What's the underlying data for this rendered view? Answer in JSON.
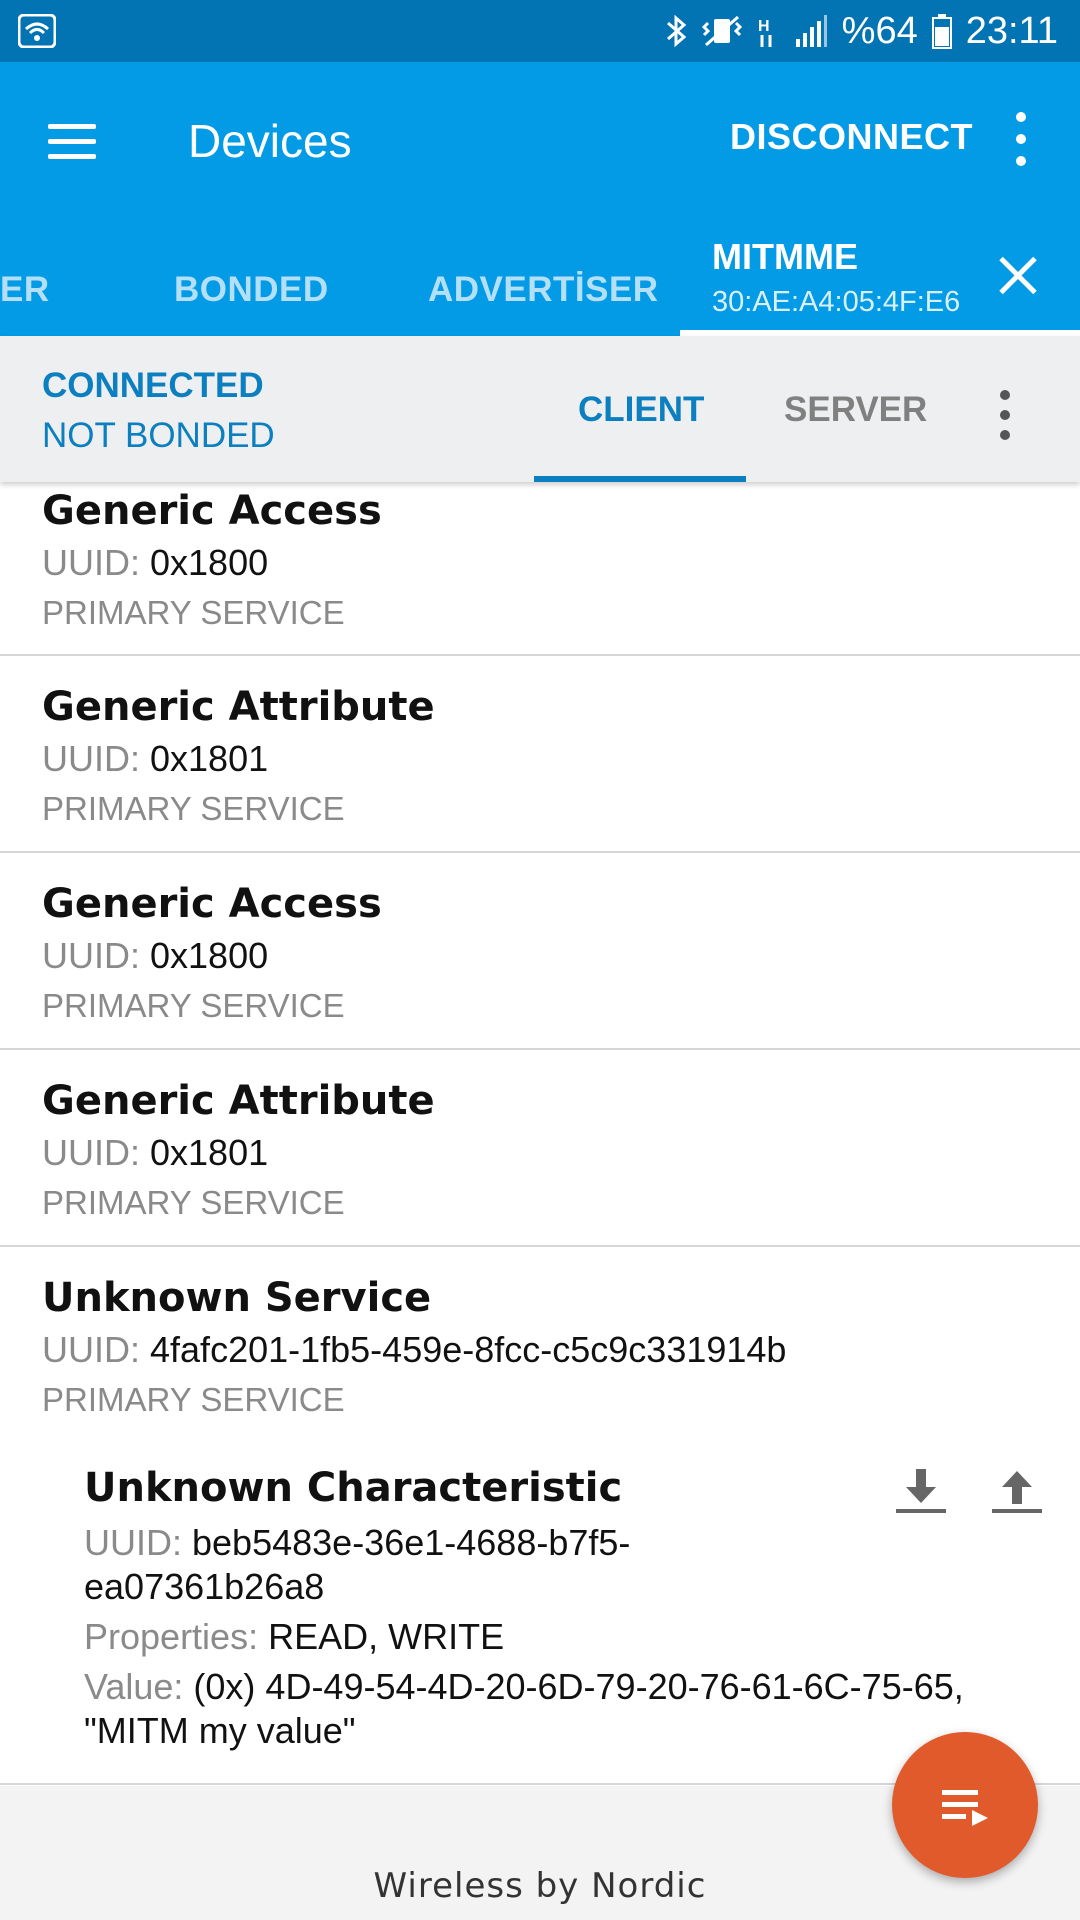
{
  "status_bar": {
    "battery": "%64",
    "time": "23:11",
    "icons": [
      "wifi-icon",
      "bluetooth-icon",
      "vibrate-icon",
      "network-h-icon",
      "signal-icon",
      "battery-icon"
    ]
  },
  "app_bar": {
    "title": "Devices",
    "disconnect_label": "DISCONNECT"
  },
  "device_tabs": {
    "items": [
      {
        "label": "ER"
      },
      {
        "label": "BONDED"
      },
      {
        "label": "ADVERTİSER"
      }
    ],
    "active": {
      "name": "MITMME",
      "address": "30:AE:A4:05:4F:E6"
    }
  },
  "connection": {
    "state": "CONNECTED",
    "bond": "NOT BONDED",
    "tabs": {
      "client": "CLIENT",
      "server": "SERVER"
    }
  },
  "services": [
    {
      "name": "Generic Access",
      "uuid_label": "UUID:",
      "uuid": "0x1800",
      "type": "PRIMARY SERVICE"
    },
    {
      "name": "Generic Attribute",
      "uuid_label": "UUID:",
      "uuid": "0x1801",
      "type": "PRIMARY SERVICE"
    },
    {
      "name": "Generic Access",
      "uuid_label": "UUID:",
      "uuid": "0x1800",
      "type": "PRIMARY SERVICE"
    },
    {
      "name": "Generic Attribute",
      "uuid_label": "UUID:",
      "uuid": "0x1801",
      "type": "PRIMARY SERVICE"
    },
    {
      "name": "Unknown Service",
      "uuid_label": "UUID:",
      "uuid": "4fafc201-1fb5-459e-8fcc-c5c9c331914b",
      "type": "PRIMARY SERVICE"
    }
  ],
  "characteristic": {
    "name": "Unknown Characteristic",
    "uuid_label": "UUID:",
    "uuid_line1": "beb5483e-36e1-4688-b7f5-",
    "uuid_line2": "ea07361b26a8",
    "properties_label": "Properties:",
    "properties": "READ, WRITE",
    "value_label": "Value:",
    "value_line1": "(0x) 4D-49-54-4D-20-6D-79-20-76-61-6C-75-65,",
    "value_line2": "\"MITM my value\""
  },
  "footer": {
    "brand": "Wireless by Nordic"
  },
  "colors": {
    "status_bar": "#0273b3",
    "app_bar": "#039be5",
    "accent": "#0b7fbf",
    "fab": "#e05a2b"
  }
}
